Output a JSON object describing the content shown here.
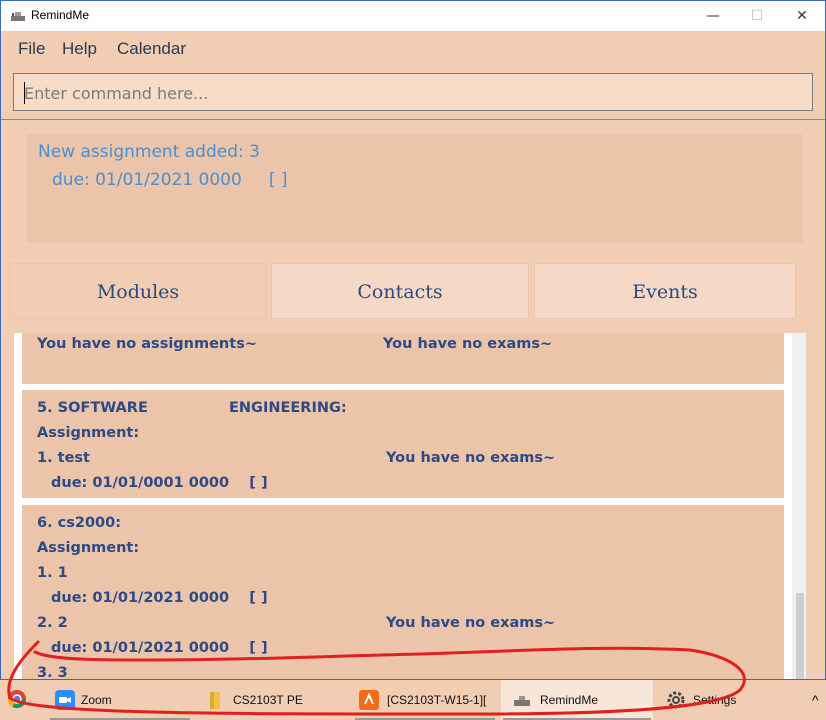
{
  "window": {
    "title": "RemindMe",
    "minimize": "—",
    "maximize": "☐",
    "close": "✕"
  },
  "menu": {
    "file": "File",
    "help": "Help",
    "calendar": "Calendar"
  },
  "command": {
    "placeholder": "Enter command here..."
  },
  "result": {
    "line1": "New assignment added: 3",
    "line2": "due: 01/01/2021 0000     [ ]"
  },
  "tabs": {
    "modules": "Modules",
    "contacts": "Contacts",
    "events": "Events"
  },
  "modules": {
    "card4": {
      "no_assignments": "You have no assignments~",
      "no_exams": "You have no exams~"
    },
    "card5": {
      "title_part1": "5. SOFTWARE",
      "title_part2": "ENGINEERING:",
      "assignment_header": "Assignment:",
      "item1_name": "1. test",
      "item1_due": "due: 01/01/0001 0000    [ ]",
      "no_exams": "You have no exams~"
    },
    "card6": {
      "title": "6. cs2000:",
      "assignment_header": "Assignment:",
      "item1_name": "1. 1",
      "item1_due": "due: 01/01/2021 0000    [ ]",
      "item2_name": "2. 2",
      "item2_due": "due: 01/01/2021 0000    [ ]",
      "item3_name": "3. 3",
      "no_exams": "You have no exams~"
    }
  },
  "taskbar": {
    "zoom": "Zoom",
    "folder": "CS2103T PE",
    "pdf": "[CS2103T-W15-1][",
    "remindme": "RemindMe",
    "settings": "Settings",
    "overflow": "^"
  },
  "colors": {
    "background": "#f0cdb3",
    "card": "#ecc4a9",
    "text_dark": "#2c4a86",
    "result_text": "#4a8fd0",
    "annotation": "#e0201e"
  }
}
